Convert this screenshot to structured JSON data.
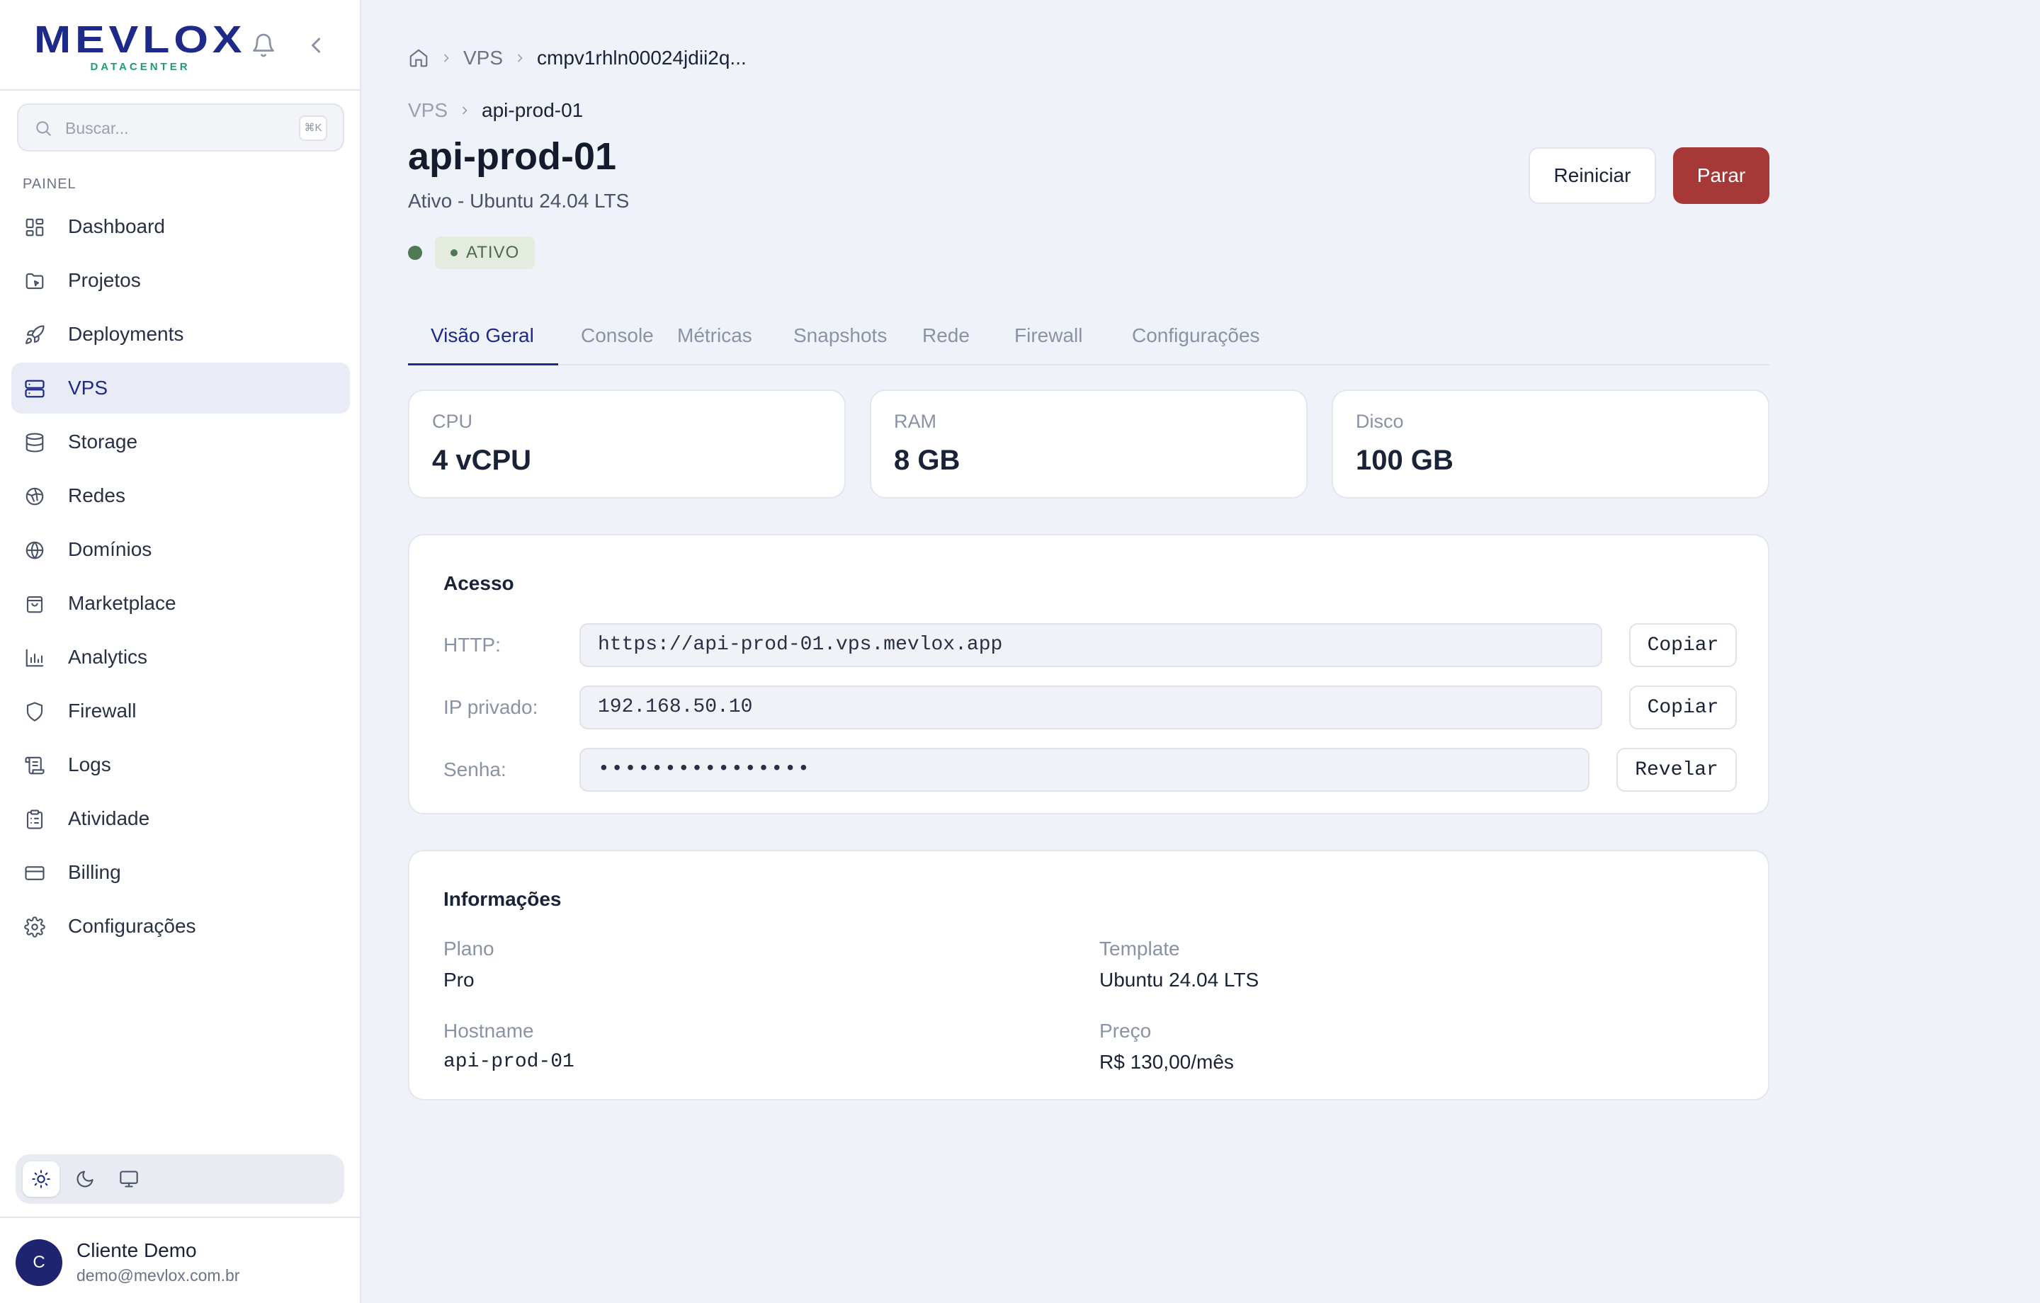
{
  "brand": {
    "name": "MEVLOX",
    "sub": "DATACENTER"
  },
  "search": {
    "placeholder": "Buscar...",
    "shortcut": "⌘K"
  },
  "sidebar": {
    "section": "PAINEL",
    "items": [
      {
        "label": "Dashboard",
        "icon": "grid-icon"
      },
      {
        "label": "Projetos",
        "icon": "folder-icon"
      },
      {
        "label": "Deployments",
        "icon": "rocket-icon"
      },
      {
        "label": "VPS",
        "icon": "server-icon",
        "active": true
      },
      {
        "label": "Storage",
        "icon": "database-icon"
      },
      {
        "label": "Redes",
        "icon": "network-icon"
      },
      {
        "label": "Domínios",
        "icon": "globe-icon"
      },
      {
        "label": "Marketplace",
        "icon": "shopping-bag-icon"
      },
      {
        "label": "Analytics",
        "icon": "bar-chart-icon"
      },
      {
        "label": "Firewall",
        "icon": "shield-icon"
      },
      {
        "label": "Logs",
        "icon": "scroll-icon"
      },
      {
        "label": "Atividade",
        "icon": "clipboard-icon"
      },
      {
        "label": "Billing",
        "icon": "credit-card-icon"
      },
      {
        "label": "Configurações",
        "icon": "gear-icon"
      }
    ]
  },
  "user": {
    "initial": "C",
    "name": "Cliente Demo",
    "email": "demo@mevlox.com.br"
  },
  "breadcrumb": {
    "section": "VPS",
    "id": "cmpv1rhln00024jdii2q..."
  },
  "breadcrumb2": {
    "section": "VPS",
    "current": "api-prod-01"
  },
  "server": {
    "name": "api-prod-01",
    "subtitle": "Ativo - Ubuntu 24.04 LTS",
    "status": "ATIVO"
  },
  "actions": {
    "restart": "Reiniciar",
    "stop": "Parar"
  },
  "tabs": [
    "Visão Geral",
    "Console",
    "Métricas",
    "Snapshots",
    "Rede",
    "Firewall",
    "Configurações"
  ],
  "stats": [
    {
      "label": "CPU",
      "value": "4 vCPU"
    },
    {
      "label": "RAM",
      "value": "8 GB"
    },
    {
      "label": "Disco",
      "value": "100 GB"
    }
  ],
  "access": {
    "title": "Acesso",
    "rows": [
      {
        "label": "HTTP:",
        "value": "https://api-prod-01.vps.mevlox.app",
        "button": "Copiar"
      },
      {
        "label": "IP privado:",
        "value": "192.168.50.10",
        "button": "Copiar"
      },
      {
        "label": "Senha:",
        "value": "••••••••••••••••",
        "button": "Revelar"
      }
    ]
  },
  "info": {
    "title": "Informações",
    "plan_label": "Plano",
    "plan_value": "Pro",
    "template_label": "Template",
    "template_value": "Ubuntu 24.04 LTS",
    "hostname_label": "Hostname",
    "hostname_value": "api-prod-01",
    "price_label": "Preço",
    "price_value": "R$ 130,00/mês"
  },
  "colors": {
    "brand": "#1e2a8a",
    "accent_green": "#1f9d6a",
    "danger": "#a73838",
    "status_active": "#4f7a55"
  }
}
